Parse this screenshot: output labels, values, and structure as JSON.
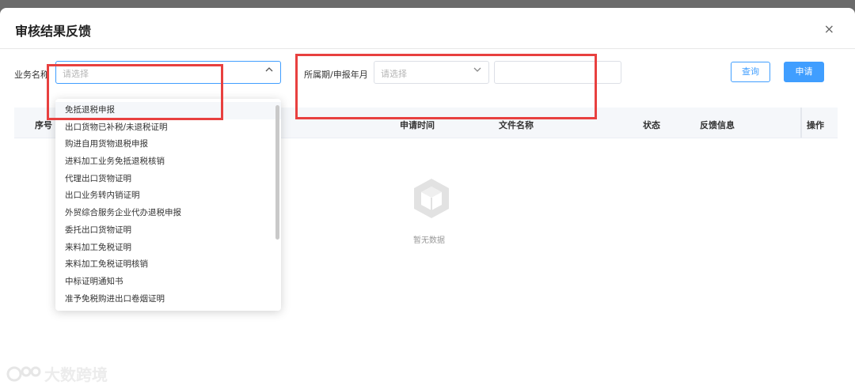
{
  "modal": {
    "title": "审核结果反馈",
    "close_glyph": "×"
  },
  "filters": {
    "business_name_label": "业务名称",
    "business_name_placeholder": "请选择",
    "period_label": "所属期/申报年月",
    "period_placeholder": "请选择",
    "query_button": "查询",
    "apply_button": "申请"
  },
  "table": {
    "headers": [
      "序号",
      "申请时间",
      "文件名称",
      "状态",
      "反馈信息",
      "操作"
    ],
    "empty_text": "暂无数据"
  },
  "dropdown": {
    "options": [
      "免抵退税申报",
      "出口货物已补税/未退税证明",
      "购进自用货物退税申报",
      "进料加工业务免抵退税核销",
      "代理出口货物证明",
      "出口业务转内销证明",
      "外贸综合服务企业代办退税申报",
      "委托出口货物证明",
      "来料加工免税证明",
      "来料加工免税证明核销",
      "中标证明通知书",
      "准予免税购进出口卷烟证明"
    ]
  },
  "watermark": {
    "text": "大数跨境"
  },
  "colors": {
    "primary": "#409eff",
    "highlight_box": "#e8403f"
  }
}
